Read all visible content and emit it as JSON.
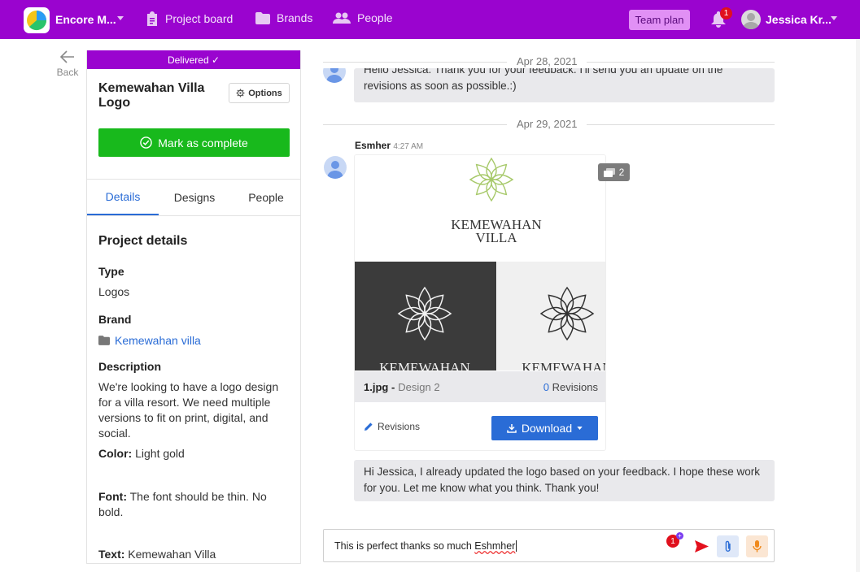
{
  "nav": {
    "workspace": "Encore M...",
    "items": [
      {
        "label": "Project board",
        "icon": "clipboard-icon"
      },
      {
        "label": "Brands",
        "icon": "folder-icon"
      },
      {
        "label": "People",
        "icon": "people-icon"
      }
    ],
    "team_plan": "Team plan",
    "notif_count": "1",
    "user_name": "Jessica Kr...",
    "accent": "#9a04cf"
  },
  "back": {
    "label": "Back"
  },
  "project": {
    "status": "Delivered ✓",
    "title": "Kemewahan Villa Logo",
    "options_label": "Options",
    "mark_complete": "Mark as complete",
    "tabs": [
      "Details",
      "Designs",
      "People"
    ],
    "details_title": "Project details",
    "type_label": "Type",
    "type_value": "Logos",
    "brand_label": "Brand",
    "brand_value": "Kemewahan villa",
    "description_label": "Description",
    "description_value": "We're looking to have a logo design for a villa resort. We need multiple versions to fit on print, digital, and social.",
    "color_label": "Color:",
    "color_value": " Light gold",
    "font_label": "Font:",
    "font_value": " The font should be thin. No bold.",
    "text_label": "Text:",
    "text_value": " Kemewahan Villa"
  },
  "chat": {
    "date1": "Apr 28, 2021",
    "msg1_line1": "Hello Jessica. Thank you for your feedback. I'll send you an update on the",
    "msg1_line2": "revisions as soon as possible.:)",
    "date2": "Apr 29, 2021",
    "sender": "Esmher",
    "sender_time": "4:27 AM",
    "design": {
      "image_count": "2",
      "logo_line1": "KEMEWAHAN",
      "logo_line2": "VILLA",
      "file_name": "1.jpg -",
      "design_name": "Design 2",
      "revision_count": "0",
      "revision_word": " Revisions",
      "revisions_link": "Revisions",
      "download_label": "Download"
    },
    "msg2": "Hi Jessica, I already updated the logo based on your feedback. I hope these work for you. Let me know what you think. Thank you!",
    "composer_text": "This is perfect thanks so much ",
    "composer_name": "Eshmher",
    "composer_badge": "1"
  }
}
